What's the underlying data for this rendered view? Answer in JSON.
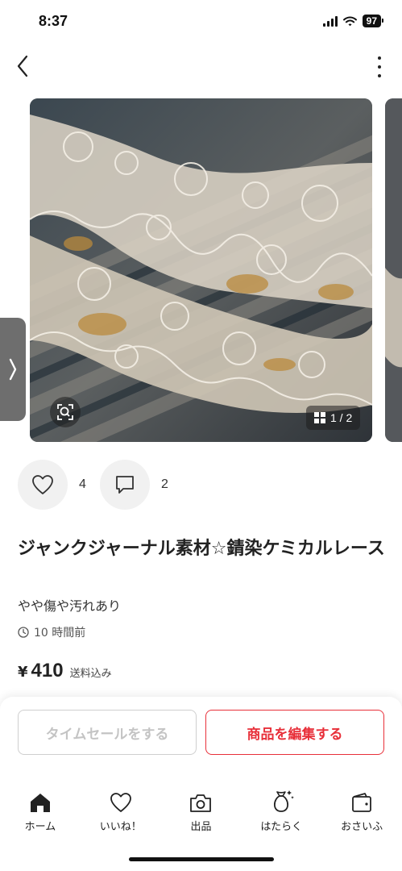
{
  "status_bar": {
    "time": "8:37",
    "battery": "97"
  },
  "gallery": {
    "page_indicator": "1 / 2"
  },
  "reactions": {
    "likes": "4",
    "comments": "2"
  },
  "item": {
    "title": "ジャンクジャーナル素材☆錆染ケミカルレース",
    "condition": "やや傷や汚れあり",
    "posted": "10 時間前",
    "price_currency": "¥",
    "price": "410",
    "price_note": "送料込み"
  },
  "actions": {
    "timesale_label": "タイムセールをする",
    "edit_label": "商品を編集する"
  },
  "tabbar": {
    "items": [
      {
        "label": "ホーム",
        "icon": "home-icon"
      },
      {
        "label": "いいね！",
        "icon": "heart-icon"
      },
      {
        "label": "出品",
        "icon": "camera-icon"
      },
      {
        "label": "はたらく",
        "icon": "money-bag-icon"
      },
      {
        "label": "おさいふ",
        "icon": "wallet-icon"
      }
    ]
  },
  "colors": {
    "accent": "#e8303a",
    "disabled_text": "#c4c4c4",
    "icon_bg": "#f1f1f1"
  }
}
